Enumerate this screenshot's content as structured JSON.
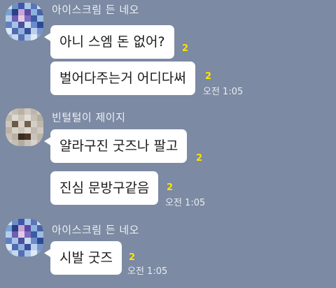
{
  "chat": {
    "groups": [
      {
        "sender": "아이스크림 든 네오",
        "messages": [
          {
            "text": "아니 스엠 돈 없어?",
            "unread": "2"
          },
          {
            "text": "벌어다주는거 어디다써",
            "unread": "2",
            "time": "오전 1:05"
          }
        ]
      },
      {
        "sender": "빈털털이 제이지",
        "messages": [
          {
            "text": "얄라구진 굿즈나 팔고",
            "unread": "2"
          },
          {
            "text": "진심 문방구같음",
            "unread": "2",
            "time": "오전 1:05"
          }
        ]
      },
      {
        "sender": "아이스크림 든 네오",
        "messages": [
          {
            "text": "시발 굿즈",
            "unread": "2",
            "time": "오전 1:05"
          }
        ]
      }
    ]
  },
  "colors": {
    "background": "#7c8aa3",
    "bubble": "#ffffff",
    "unread": "#ffe400",
    "meta_text": "#e9edf3"
  },
  "icons": {
    "avatar_neo": "pixelated-avatar-icon",
    "avatar_jayg": "pixelated-avatar-icon"
  }
}
